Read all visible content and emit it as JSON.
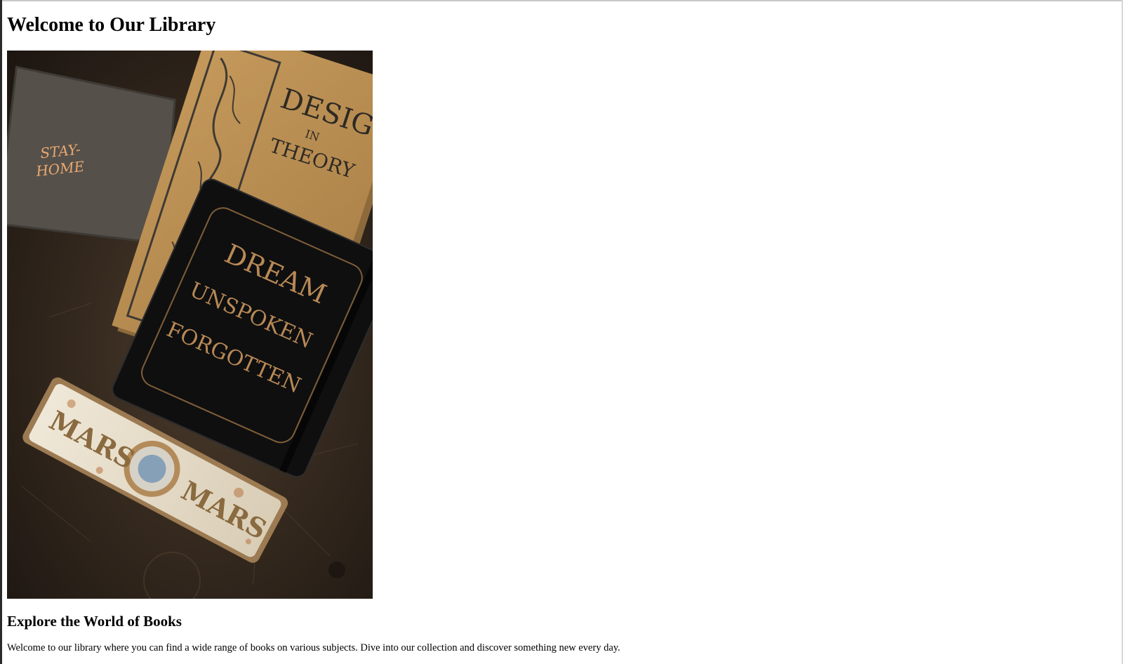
{
  "header": {
    "title": "Welcome to Our Library"
  },
  "hero": {
    "icon": "books-photo",
    "book1_title_line1": "DESIG",
    "book1_title_line2": "IN",
    "book1_title_line3": "THEORY",
    "notebook_text1": "DREAM",
    "notebook_text2": "UNSPOKEN",
    "notebook_text3": "FORGOTTEN",
    "tag_text1": "STAY-",
    "tag_text2": "HOME",
    "tin_text1": "MARS",
    "tin_text2": "MARS"
  },
  "section": {
    "heading": "Explore the World of Books",
    "body": "Welcome to our library where you can find a wide range of books on various subjects. Dive into our collection and discover something new every day."
  },
  "colors": {
    "background": "#ffffff",
    "text": "#000000",
    "photo_table": "#2b2119",
    "book_cover": "#b08850",
    "notebook": "#141414",
    "tin": "#e4dccb"
  }
}
